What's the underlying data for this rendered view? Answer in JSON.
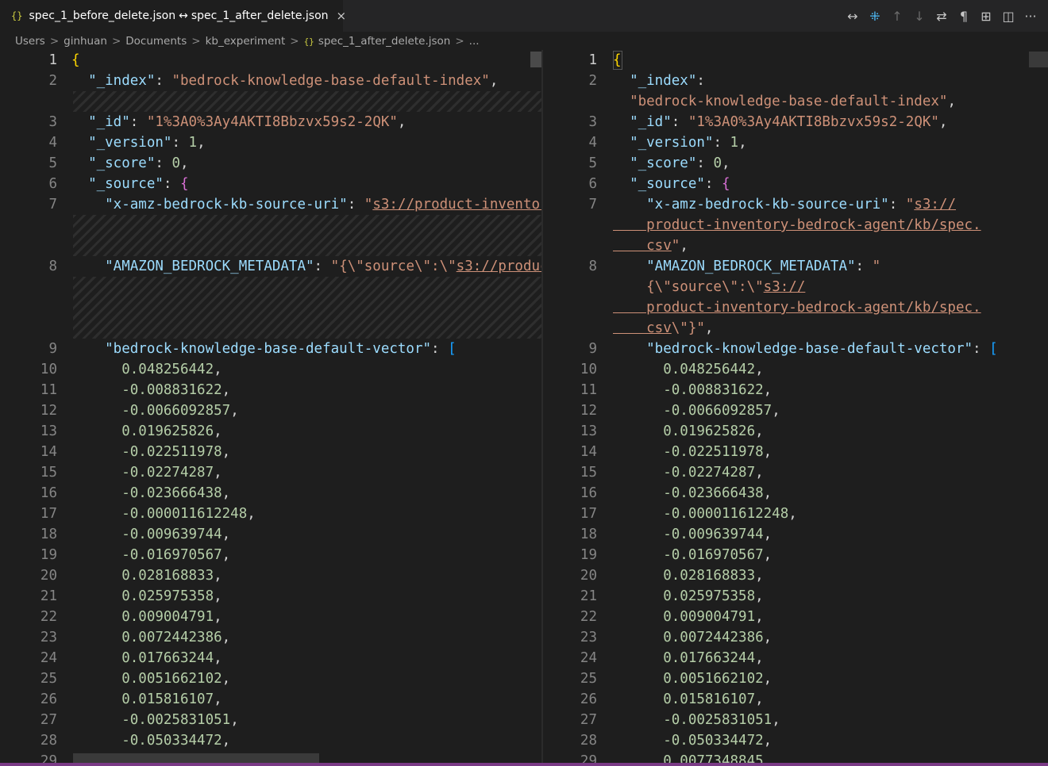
{
  "tab": {
    "left_file": "spec_1_before_delete.json",
    "arrow": "↔",
    "right_file": "spec_1_after_delete.json",
    "json_icon": "{}",
    "close": "×"
  },
  "actions": [
    {
      "name": "swap-sides-icon",
      "glyph": "↔"
    },
    {
      "name": "collapse-unchanged-icon",
      "glyph": "⁜"
    },
    {
      "name": "previous-change-icon",
      "glyph": "↑"
    },
    {
      "name": "next-change-icon",
      "glyph": "↓"
    },
    {
      "name": "toggle-inline-icon",
      "glyph": "⇄"
    },
    {
      "name": "show-whitespace-icon",
      "glyph": "¶"
    },
    {
      "name": "open-map-icon",
      "glyph": "⊞"
    },
    {
      "name": "split-editor-icon",
      "glyph": "◫"
    },
    {
      "name": "more-actions-icon",
      "glyph": "···"
    }
  ],
  "breadcrumb": {
    "items": [
      "Users",
      "ginhuan",
      "Documents",
      "kb_experiment",
      "spec_1_after_delete.json",
      "..."
    ],
    "sep": ">"
  },
  "left": {
    "lines": [
      {
        "n": "1",
        "t": [
          [
            "b1",
            "{"
          ]
        ]
      },
      {
        "n": "2",
        "t": [
          [
            "key",
            "  \"_index\""
          ],
          [
            "p",
            ": "
          ],
          [
            "str",
            "\"bedrock-knowledge-base-default-index\""
          ],
          [
            "p",
            ","
          ]
        ]
      },
      {
        "n": "3",
        "t": [
          [
            "key",
            "  \"_id\""
          ],
          [
            "p",
            ": "
          ],
          [
            "str",
            "\"1%3A0%3Ay4AKTI8Bbzvx59s2-2QK\""
          ],
          [
            "p",
            ","
          ]
        ]
      },
      {
        "n": "4",
        "t": [
          [
            "key",
            "  \"_version\""
          ],
          [
            "p",
            ": "
          ],
          [
            "num",
            "1"
          ],
          [
            "p",
            ","
          ]
        ]
      },
      {
        "n": "5",
        "t": [
          [
            "key",
            "  \"_score\""
          ],
          [
            "p",
            ": "
          ],
          [
            "num",
            "0"
          ],
          [
            "p",
            ","
          ]
        ]
      },
      {
        "n": "6",
        "t": [
          [
            "key",
            "  \"_source\""
          ],
          [
            "p",
            ": "
          ],
          [
            "b2",
            "{"
          ]
        ]
      },
      {
        "n": "7",
        "t": [
          [
            "key",
            "    \"x-amz-bedrock-kb-source-uri\""
          ],
          [
            "p",
            ": "
          ],
          [
            "str",
            "\""
          ],
          [
            "str link",
            "s3://product-inventory-bedrock-agent/kb/spec.csv"
          ]
        ]
      },
      {
        "n": "8",
        "t": [
          [
            "key",
            "    \"AMAZON_BEDROCK_METADATA\""
          ],
          [
            "p",
            ": "
          ],
          [
            "str",
            "\"{\\\"source\\\":\\\""
          ],
          [
            "str link",
            "s3://product-inventory-bedrock-agent/kb/spec.csv"
          ]
        ]
      },
      {
        "n": "9",
        "t": [
          [
            "key",
            "    \"bedrock-knowledge-base-default-vector\""
          ],
          [
            "p",
            ": "
          ],
          [
            "b3",
            "["
          ]
        ]
      }
    ]
  },
  "right": {
    "lines": [
      {
        "n": "1",
        "t": [
          [
            "b1",
            "{"
          ]
        ]
      },
      {
        "n": "2",
        "t": [
          [
            "key",
            "  \"_index\""
          ],
          [
            "p",
            ":"
          ]
        ]
      },
      {
        "n": "",
        "t": [
          [
            "str",
            "  \"bedrock-knowledge-base-default-index\""
          ],
          [
            "p",
            ","
          ]
        ]
      },
      {
        "n": "3",
        "t": [
          [
            "key",
            "  \"_id\""
          ],
          [
            "p",
            ": "
          ],
          [
            "str",
            "\"1%3A0%3Ay4AKTI8Bbzvx59s2-2QK\""
          ],
          [
            "p",
            ","
          ]
        ]
      },
      {
        "n": "4",
        "t": [
          [
            "key",
            "  \"_version\""
          ],
          [
            "p",
            ": "
          ],
          [
            "num",
            "1"
          ],
          [
            "p",
            ","
          ]
        ]
      },
      {
        "n": "5",
        "t": [
          [
            "key",
            "  \"_score\""
          ],
          [
            "p",
            ": "
          ],
          [
            "num",
            "0"
          ],
          [
            "p",
            ","
          ]
        ]
      },
      {
        "n": "6",
        "t": [
          [
            "key",
            "  \"_source\""
          ],
          [
            "p",
            ": "
          ],
          [
            "b2",
            "{"
          ]
        ]
      },
      {
        "n": "7",
        "t": [
          [
            "key",
            "    \"x-amz-bedrock-kb-source-uri\""
          ],
          [
            "p",
            ": "
          ],
          [
            "str",
            "\""
          ],
          [
            "str link",
            "s3://"
          ]
        ]
      },
      {
        "n": "",
        "t": [
          [
            "str link",
            "    product-inventory-bedrock-agent/kb/spec."
          ]
        ]
      },
      {
        "n": "",
        "t": [
          [
            "str link",
            "    csv"
          ],
          [
            "str",
            "\""
          ],
          [
            "p",
            ","
          ]
        ]
      },
      {
        "n": "8",
        "t": [
          [
            "key",
            "    \"AMAZON_BEDROCK_METADATA\""
          ],
          [
            "p",
            ": "
          ],
          [
            "str",
            "\""
          ]
        ]
      },
      {
        "n": "",
        "t": [
          [
            "str",
            "    {\\\"source\\\":\\\""
          ],
          [
            "str link",
            "s3://"
          ]
        ]
      },
      {
        "n": "",
        "t": [
          [
            "str link",
            "    product-inventory-bedrock-agent/kb/spec."
          ]
        ]
      },
      {
        "n": "",
        "t": [
          [
            "str link",
            "    csv"
          ],
          [
            "str",
            "\\\"}\""
          ],
          [
            "p",
            ","
          ]
        ]
      },
      {
        "n": "9",
        "t": [
          [
            "key",
            "    \"bedrock-knowledge-base-default-vector\""
          ],
          [
            "p",
            ": "
          ],
          [
            "b3",
            "["
          ]
        ]
      }
    ]
  },
  "vector": [
    {
      "n": "10",
      "v": "0.048256442"
    },
    {
      "n": "11",
      "v": "-0.008831622"
    },
    {
      "n": "12",
      "v": "-0.0066092857"
    },
    {
      "n": "13",
      "v": "0.019625826"
    },
    {
      "n": "14",
      "v": "-0.022511978"
    },
    {
      "n": "15",
      "v": "-0.02274287"
    },
    {
      "n": "16",
      "v": "-0.023666438"
    },
    {
      "n": "17",
      "v": "-0.000011612248"
    },
    {
      "n": "18",
      "v": "-0.009639744"
    },
    {
      "n": "19",
      "v": "-0.016970567"
    },
    {
      "n": "20",
      "v": "0.028168833"
    },
    {
      "n": "21",
      "v": "0.025975358"
    },
    {
      "n": "22",
      "v": "0.009004791"
    },
    {
      "n": "23",
      "v": "0.0072442386"
    },
    {
      "n": "24",
      "v": "0.017663244"
    },
    {
      "n": "25",
      "v": "0.0051662102"
    },
    {
      "n": "26",
      "v": "0.015816107"
    },
    {
      "n": "27",
      "v": "-0.0025831051"
    },
    {
      "n": "28",
      "v": "-0.050334472"
    },
    {
      "n": "29",
      "v": "0.0077348845"
    }
  ]
}
